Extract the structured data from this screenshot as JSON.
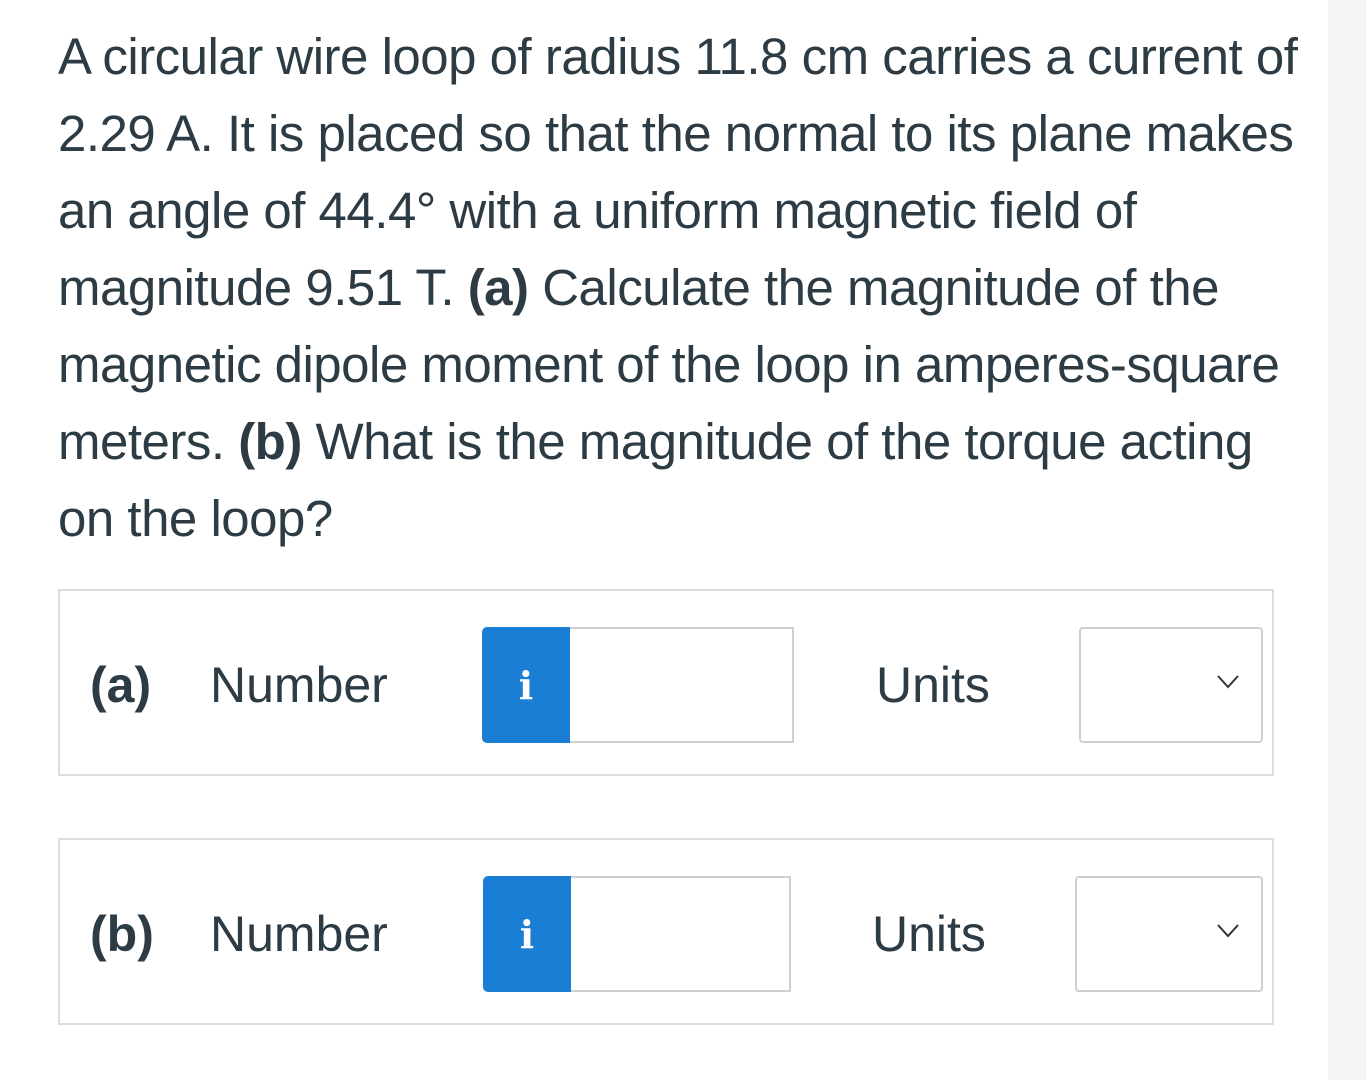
{
  "question": {
    "seg1": "A circular wire loop of radius 11.8 cm carries a current of 2.29 A. It is placed so that the normal to its plane makes an angle of 44.4° with a uniform magnetic field of magnitude 9.51 T. ",
    "seg2": "(a)",
    "seg3": " Calculate the magnitude of the magnetic dipole moment of the loop in amperes-square meters. ",
    "seg4": "(b)",
    "seg5": " What is the magnitude of the torque acting on the loop?"
  },
  "parts": [
    {
      "label": "(a)",
      "number_label": "Number",
      "info_icon": "i",
      "number_value": "",
      "units_label": "Units",
      "units_selected": ""
    },
    {
      "label": "(b)",
      "number_label": "Number",
      "info_icon": "i",
      "number_value": "",
      "units_label": "Units",
      "units_selected": ""
    }
  ],
  "colors": {
    "text": "#2d3b45",
    "info_button": "#1a7fd4",
    "border": "#dcdcdc"
  }
}
